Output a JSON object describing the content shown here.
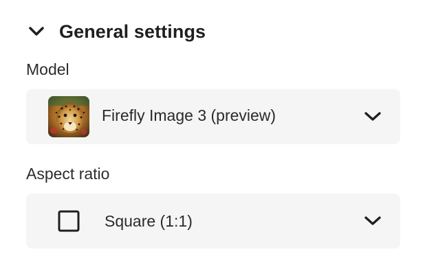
{
  "section": {
    "title": "General settings",
    "expanded": true,
    "chevron_icon": "chevron-down-icon"
  },
  "model": {
    "label": "Model",
    "selected_value": "Firefly Image 3 (preview)",
    "thumbnail_icon": "leopard-thumbnail",
    "dropdown_icon": "chevron-down-icon"
  },
  "aspect_ratio": {
    "label": "Aspect ratio",
    "selected_value": "Square (1:1)",
    "shape_icon": "square-icon",
    "dropdown_icon": "chevron-down-icon"
  },
  "colors": {
    "picker_background": "#f5f5f5",
    "text": "#222222"
  }
}
